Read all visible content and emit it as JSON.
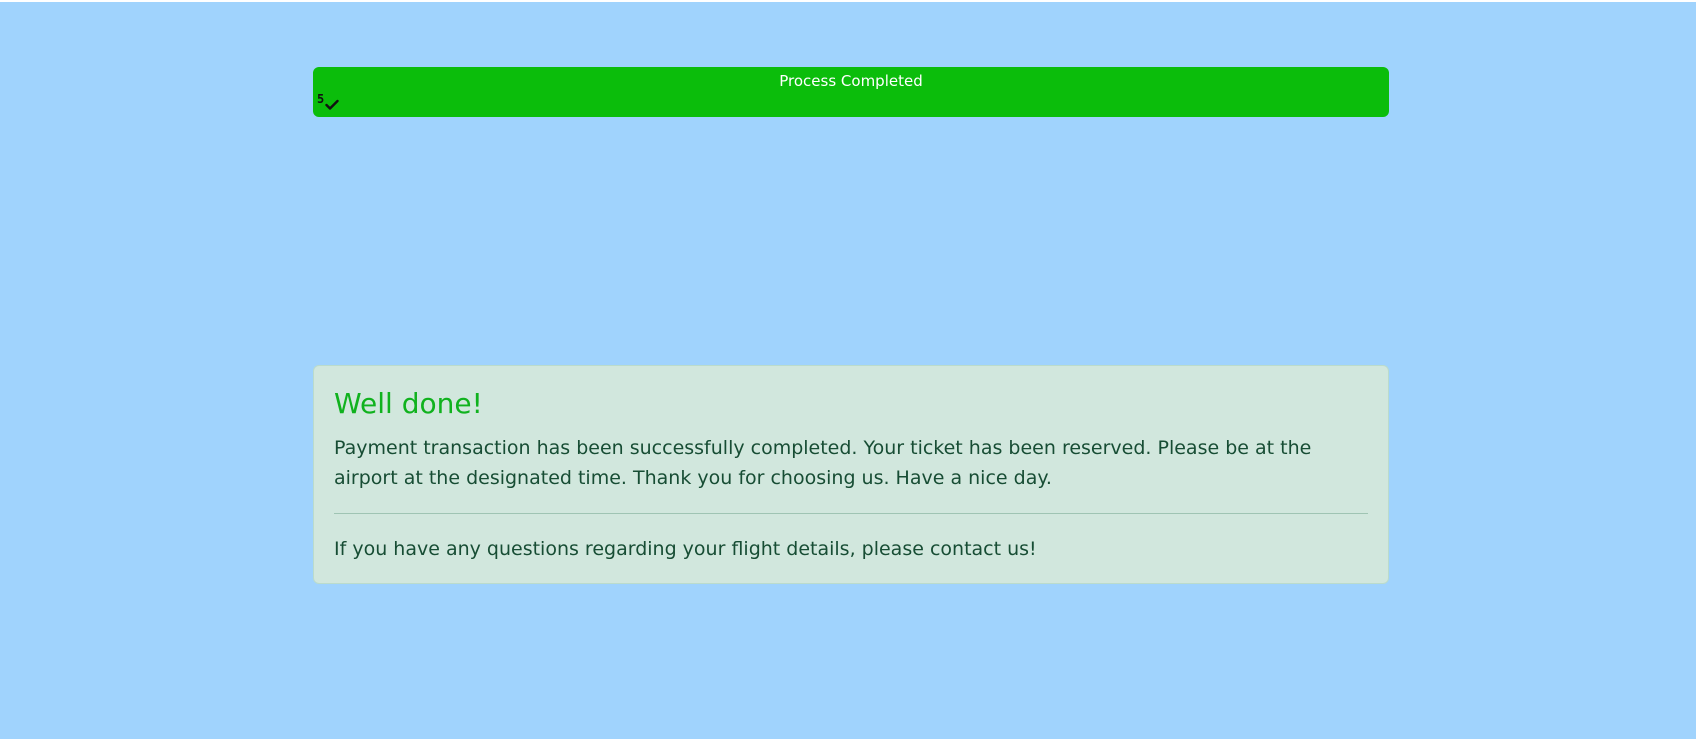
{
  "progress": {
    "label": "Process Completed",
    "step_number": "5",
    "percent": 100,
    "bar_color": "#0bbd0b"
  },
  "alert": {
    "heading": "Well done!",
    "message": "Payment transaction has been successfully completed. Your ticket has been reserved. Please be at the airport at the designated time. Thank you for choosing us. Have a nice day.",
    "footer": "If you have any questions regarding your flight details, please contact us!",
    "heading_color": "#10b21e",
    "background_color": "#d1e7dd"
  },
  "colors": {
    "page_background": "#a0d3fd",
    "text": "#174d34"
  },
  "icons": {
    "step_complete": "check-icon"
  }
}
